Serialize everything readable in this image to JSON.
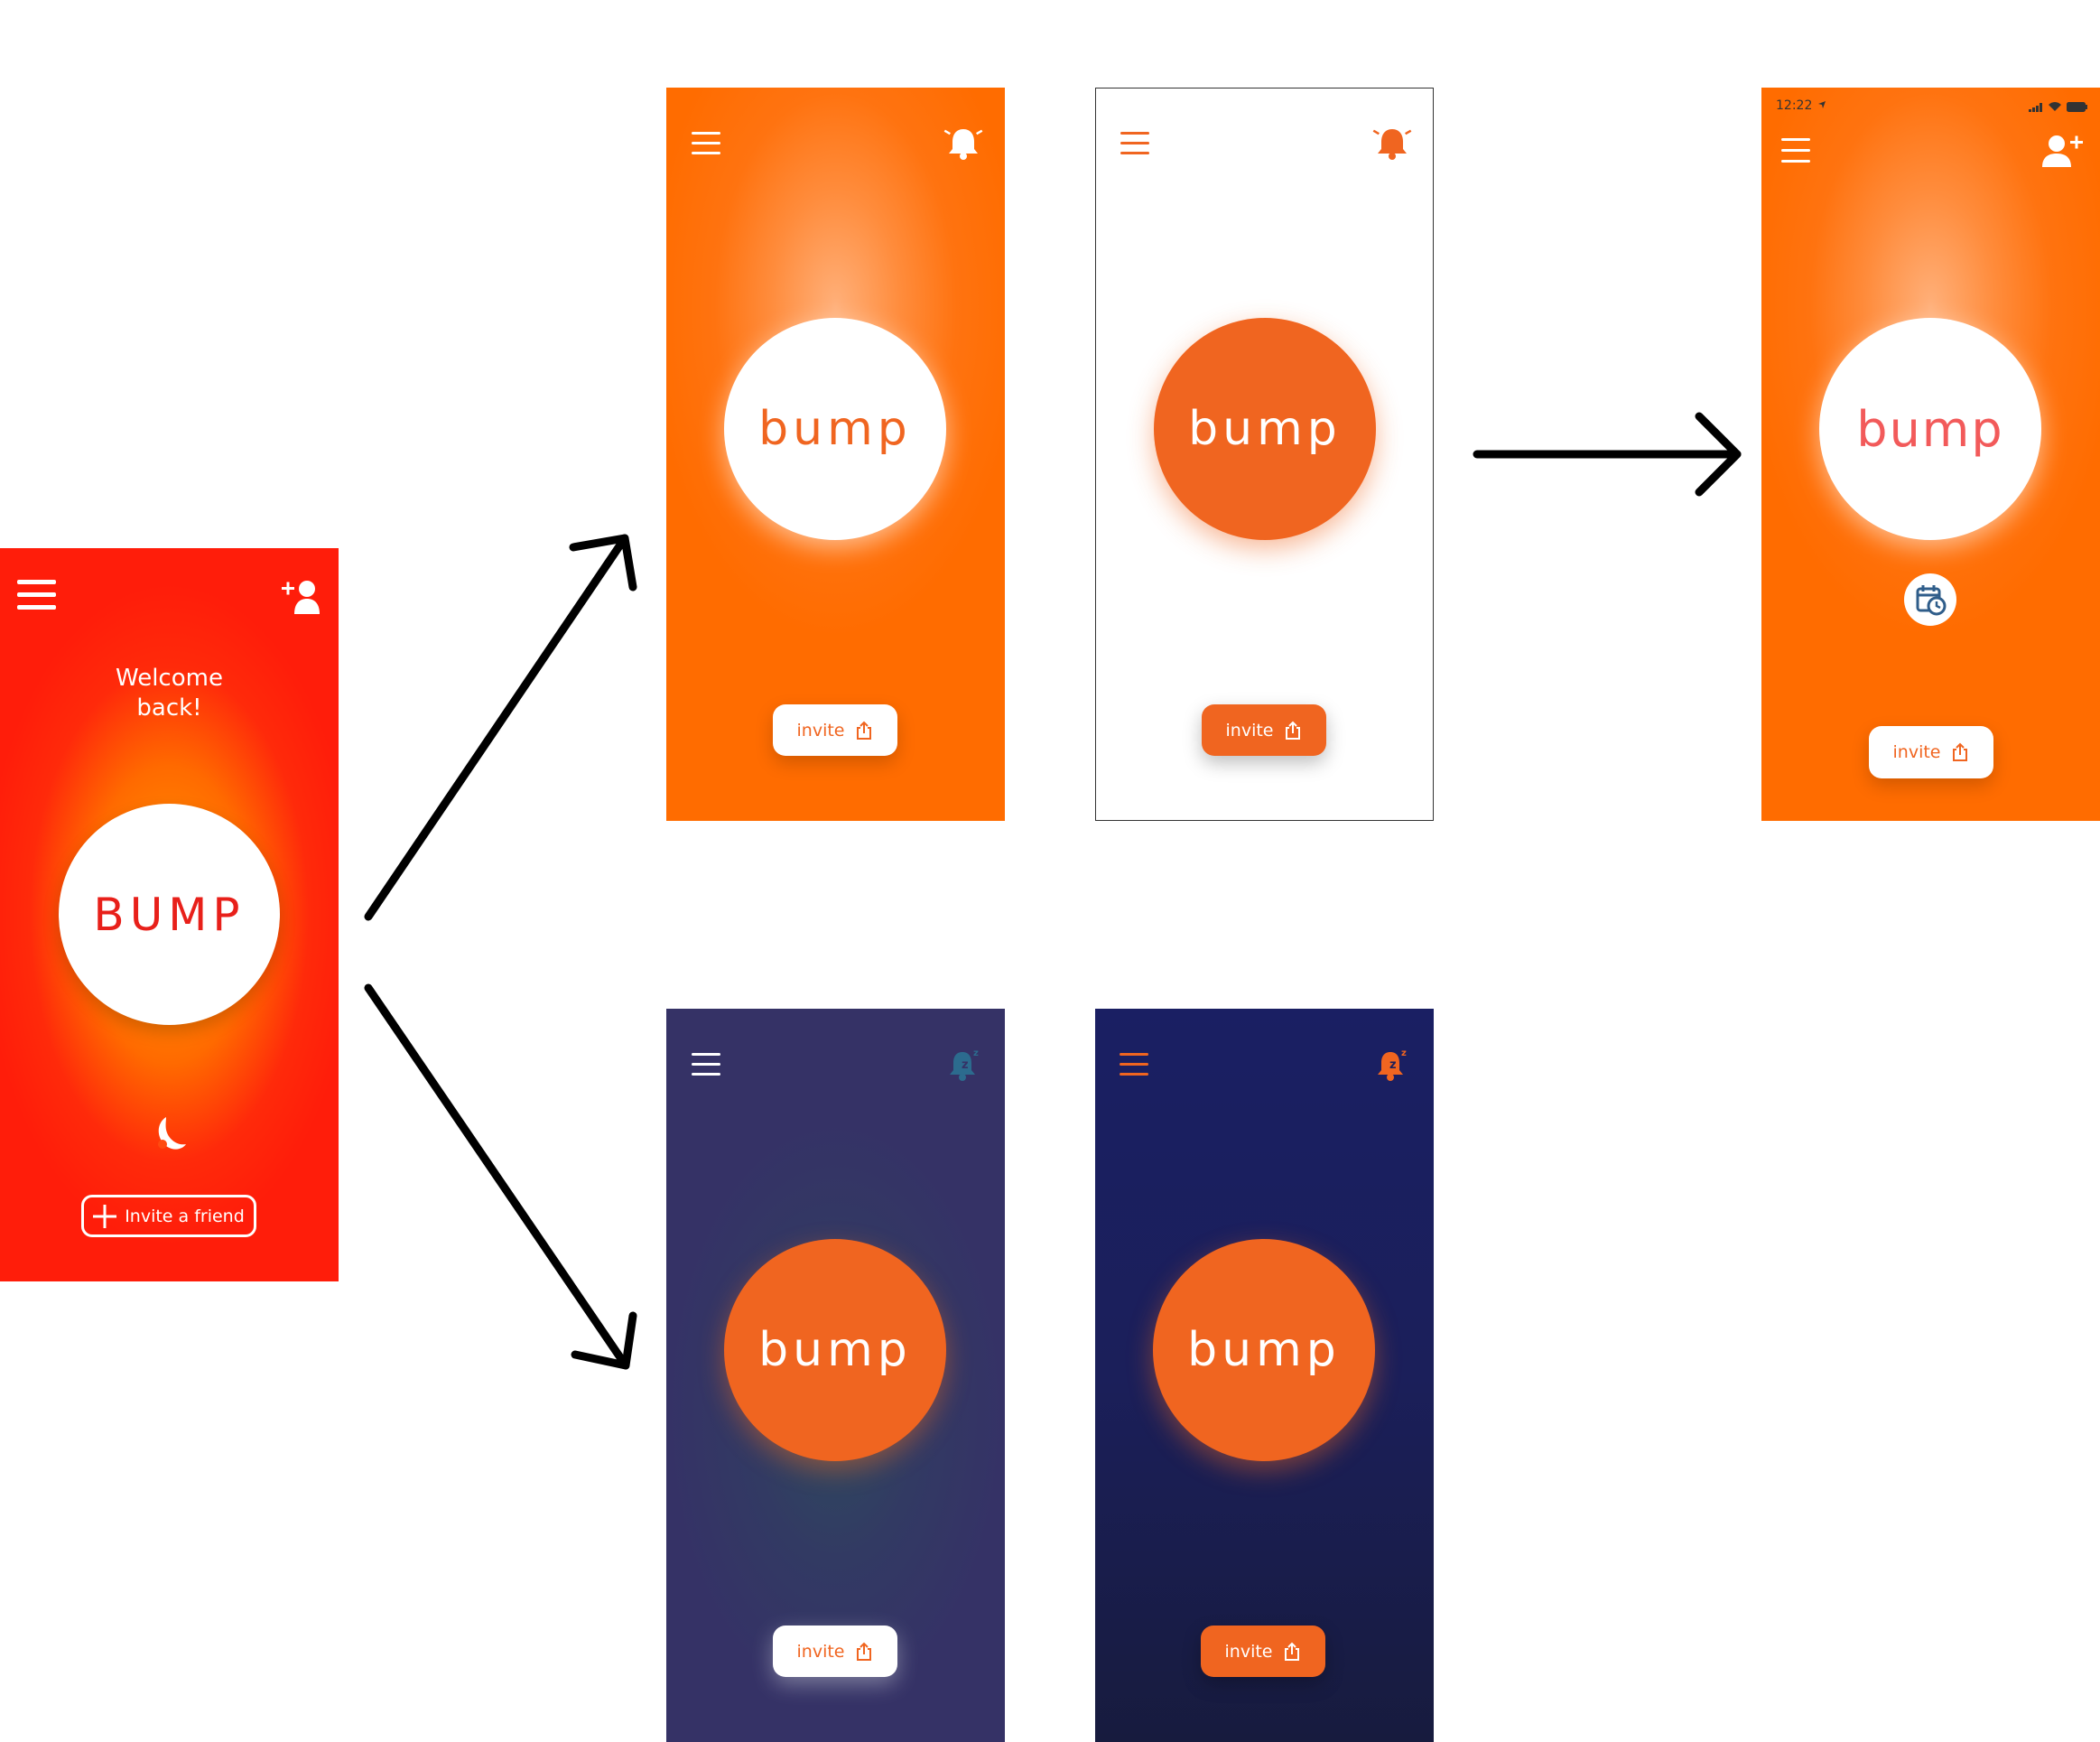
{
  "screens": {
    "left": {
      "greeting": "Welcome back!",
      "greeting_line1": "Welcome",
      "greeting_line2": "back!",
      "bump_label": "BUMP",
      "invite_label": "Invite a friend",
      "icons": [
        "hamburger-menu-icon",
        "add-user-icon",
        "moon-sleep-icon",
        "plus-icon"
      ]
    },
    "orange_1": {
      "bump_label": "bump",
      "invite_label": "invite",
      "icons": [
        "hamburger-menu-icon",
        "bell-ringing-icon",
        "share-icon"
      ]
    },
    "white": {
      "bump_label": "bump",
      "invite_label": "invite",
      "icons": [
        "hamburger-menu-icon",
        "bell-ringing-icon",
        "share-icon"
      ]
    },
    "orange_2": {
      "status_time": "12:22",
      "bump_label": "bump",
      "invite_label": "invite",
      "icons": [
        "location-arrow-icon",
        "signal-icon",
        "wifi-icon",
        "battery-icon",
        "hamburger-menu-icon",
        "add-user-icon",
        "calendar-clock-icon",
        "share-icon"
      ]
    },
    "purple": {
      "bump_label": "bump",
      "invite_label": "invite",
      "icons": [
        "hamburger-menu-icon",
        "bell-snooze-icon",
        "share-icon"
      ]
    },
    "navy": {
      "bump_label": "bump",
      "invite_label": "invite",
      "icons": [
        "hamburger-menu-icon",
        "bell-snooze-icon",
        "share-icon"
      ]
    }
  },
  "colors": {
    "accent_orange": "#f06520",
    "bump_red": "#e8201a",
    "bump_pink": "#f25a5a",
    "calendar_blue": "#2f5d8a",
    "navy": "#1a1f63",
    "purple": "#353266",
    "arrow": "#000000"
  }
}
